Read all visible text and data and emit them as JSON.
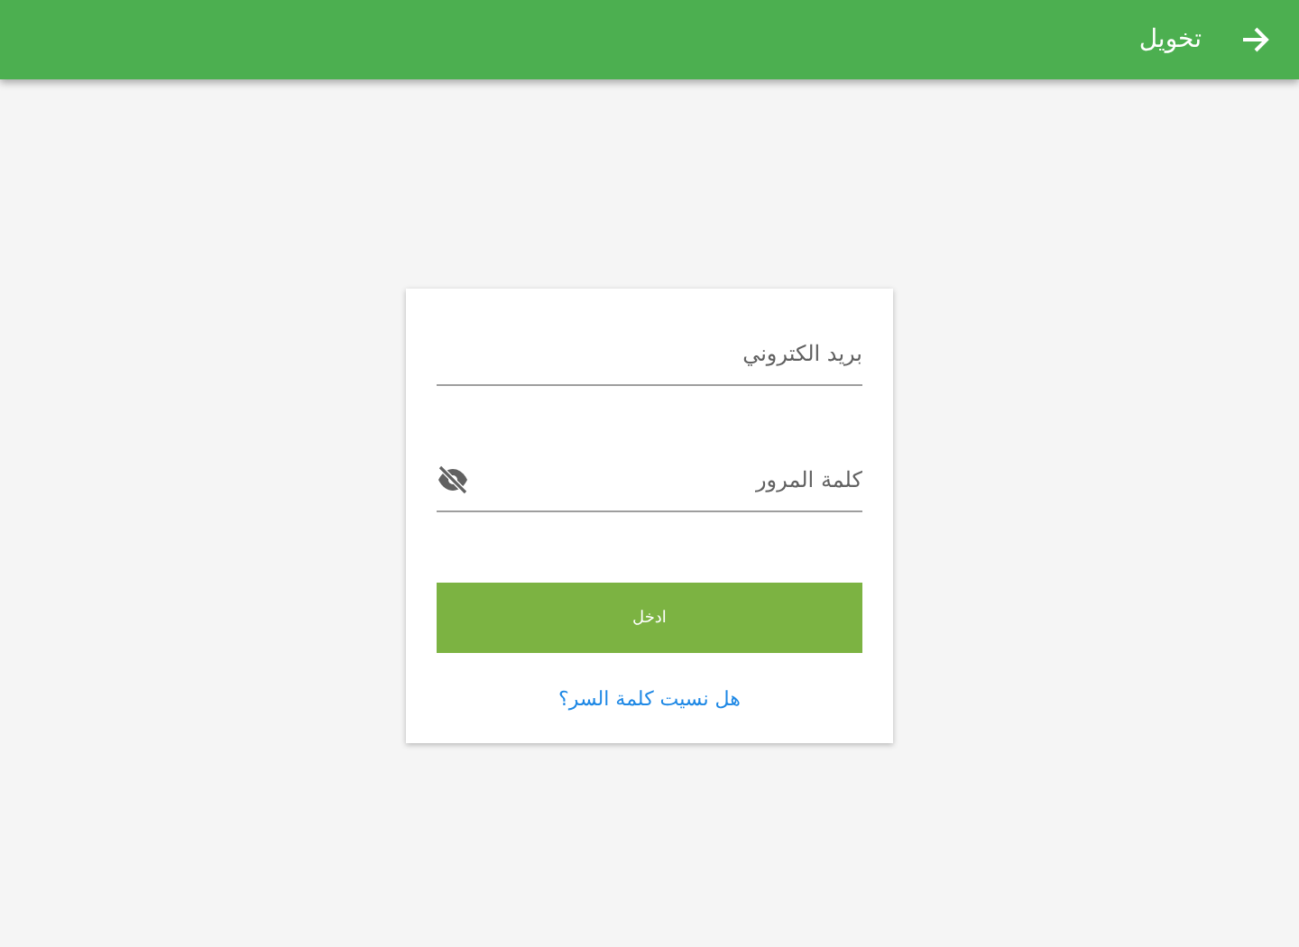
{
  "app_bar": {
    "title": "تخويل"
  },
  "form": {
    "email": {
      "placeholder": "بريد الكتروني"
    },
    "password": {
      "placeholder": "كلمة المرور",
      "visible": false
    },
    "submit": "ادخل",
    "forgot_link": "هل نسيت كلمة السر؟"
  }
}
